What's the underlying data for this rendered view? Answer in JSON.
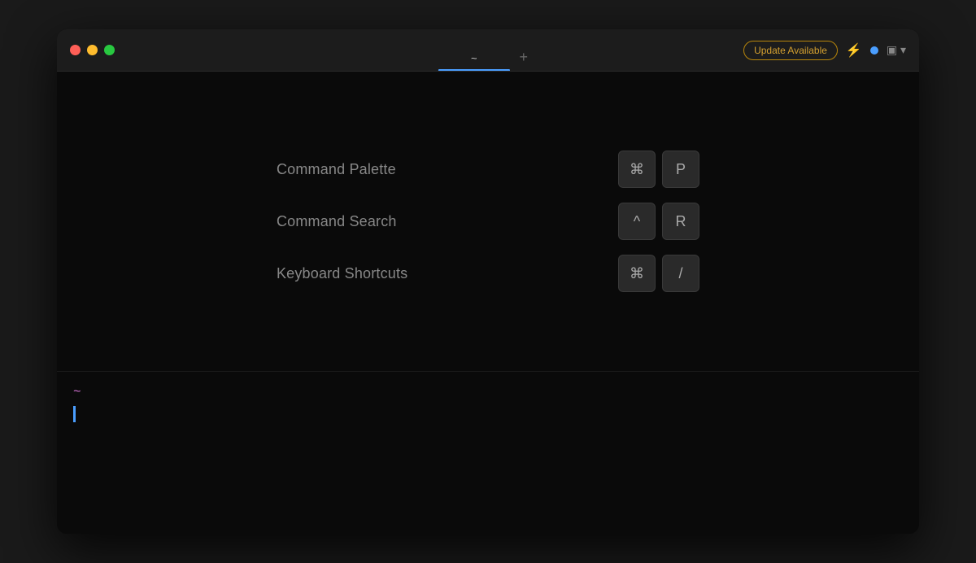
{
  "window": {
    "title": "~"
  },
  "titlebar": {
    "tab_label": "~",
    "tab_add_label": "+",
    "update_button_label": "Update Available",
    "traffic_lights": {
      "close_color": "#ff5f57",
      "minimize_color": "#febc2e",
      "maximize_color": "#28c840"
    }
  },
  "shortcuts": {
    "heading": "Keyboard Shortcuts",
    "items": [
      {
        "label": "Command Palette",
        "keys": [
          "⌘",
          "P"
        ]
      },
      {
        "label": "Command Search",
        "keys": [
          "^",
          "R"
        ]
      },
      {
        "label": "Keyboard Shortcuts",
        "keys": [
          "⌘",
          "/"
        ]
      }
    ]
  },
  "terminal": {
    "prompt": "~"
  }
}
